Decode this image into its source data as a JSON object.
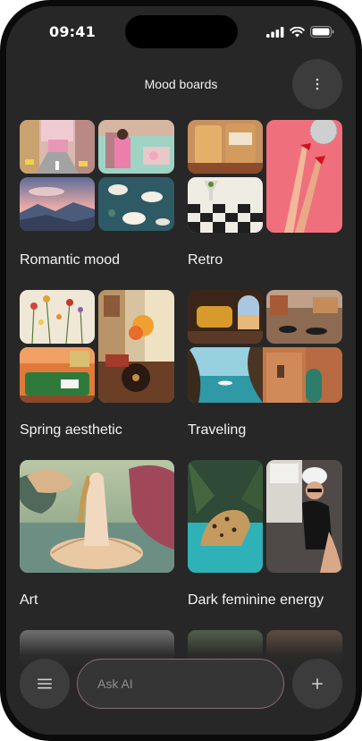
{
  "status_bar": {
    "time": "09:41"
  },
  "header": {
    "title": "Mood boards",
    "more_icon": "more-vertical-icon"
  },
  "boards": [
    {
      "label": "Romantic mood"
    },
    {
      "label": "Retro"
    },
    {
      "label": "Spring aesthetic"
    },
    {
      "label": "Traveling"
    },
    {
      "label": "Art"
    },
    {
      "label": "Dark feminine energy"
    }
  ],
  "bottom_bar": {
    "menu_icon": "menu-icon",
    "ask_placeholder": "Ask AI",
    "add_icon": "plus-icon"
  },
  "colors": {
    "background": "#272727",
    "button": "#3c3c3c",
    "text": "#f3f3f3"
  }
}
